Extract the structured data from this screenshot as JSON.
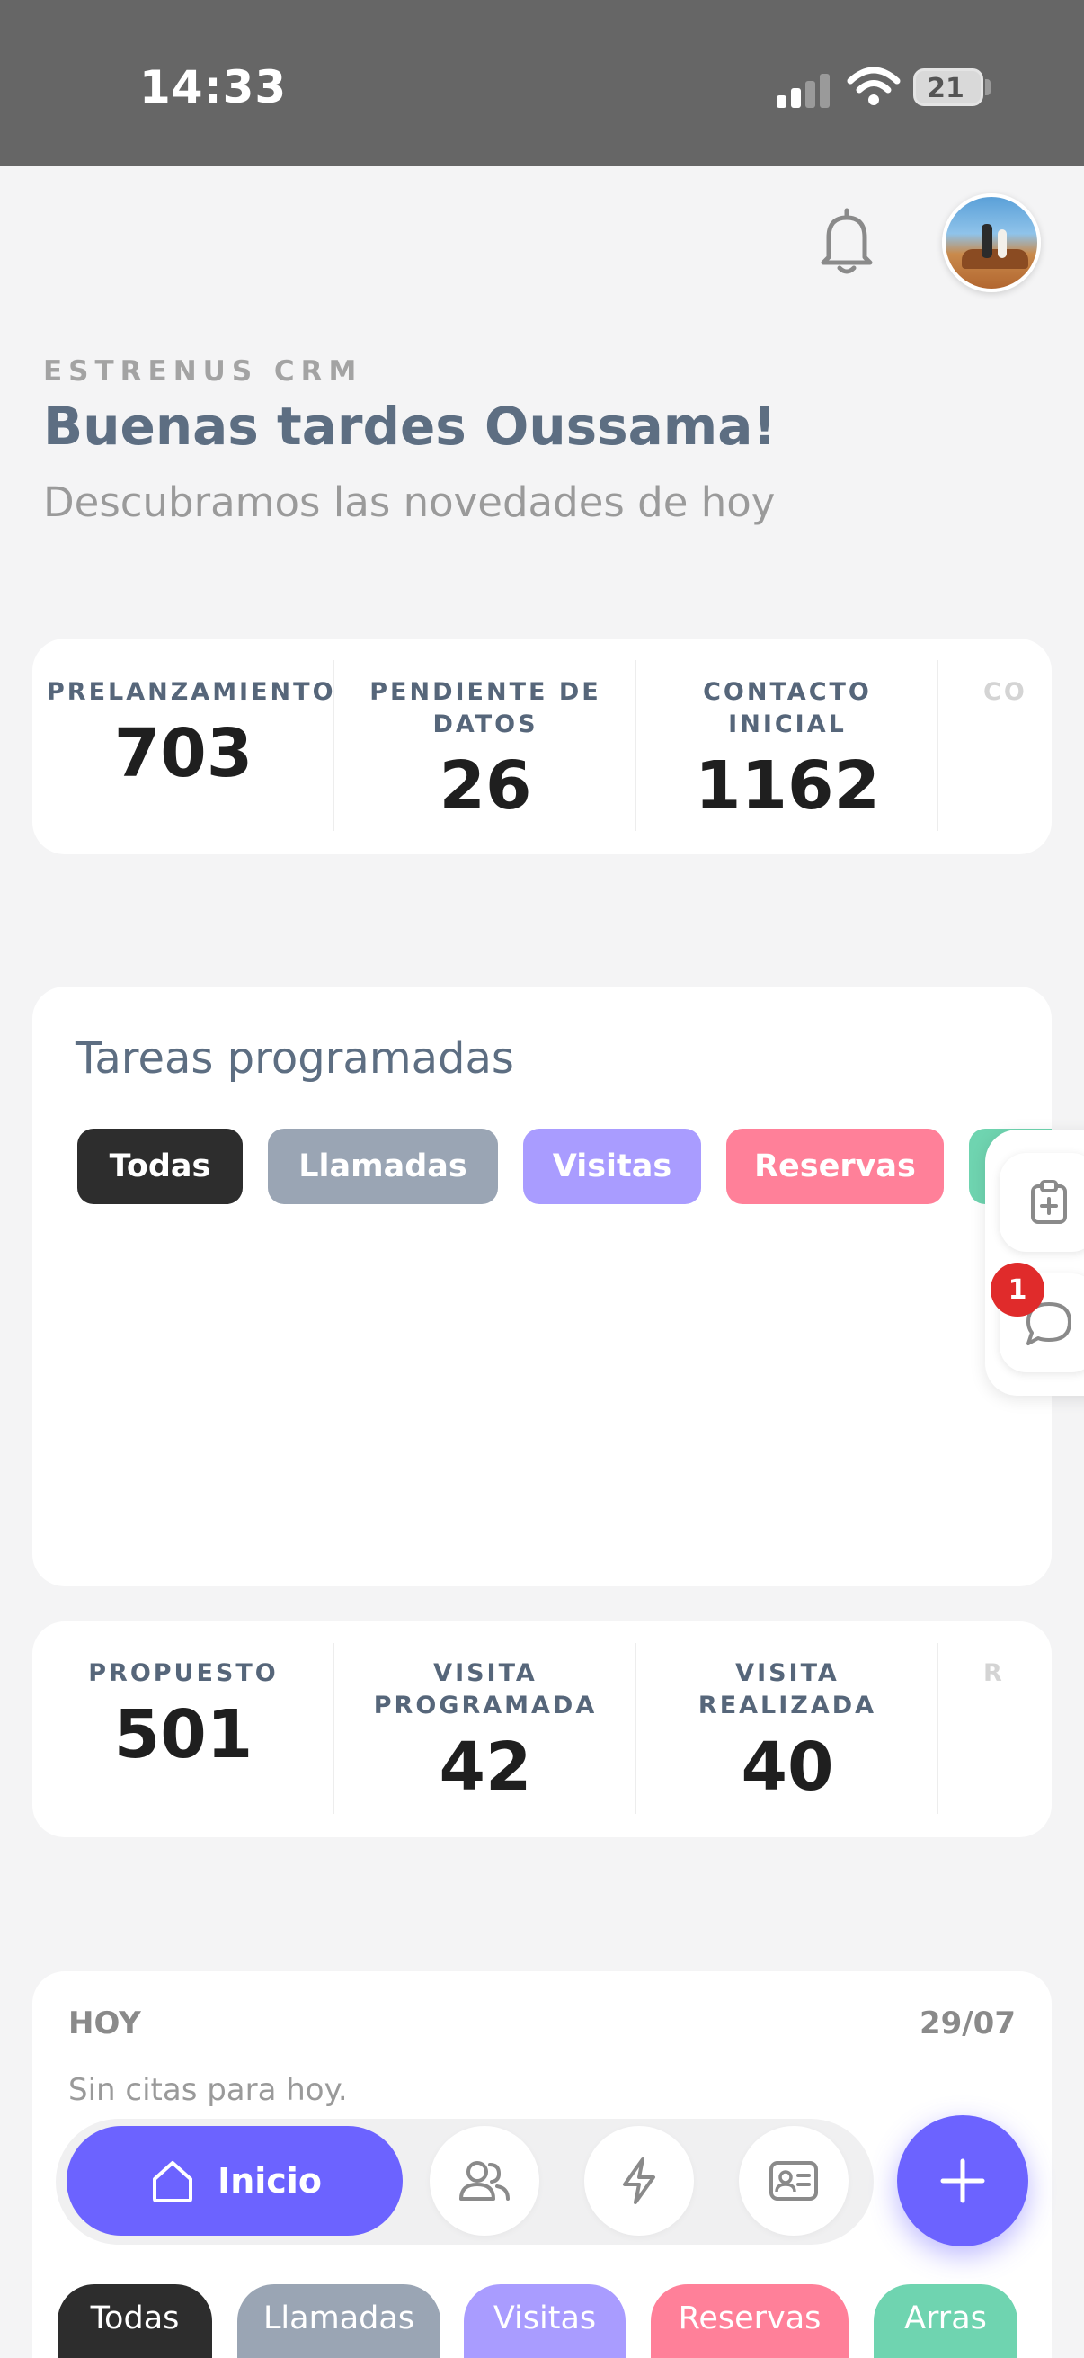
{
  "status_bar": {
    "time": "14:33",
    "battery": "21"
  },
  "header": {
    "brand": "ESTRENUS CRM",
    "greeting": "Buenas tardes Oussama!",
    "subtitle": "Descubramos las novedades de hoy"
  },
  "stats_top": [
    {
      "label": "PRELANZAMIENTO",
      "value": "703"
    },
    {
      "label": "PENDIENTE DE DATOS",
      "value": "26"
    },
    {
      "label": "CONTACTO INICIAL",
      "value": "1162"
    },
    {
      "label": "CO",
      "value": ""
    }
  ],
  "tasks": {
    "title": "Tareas programadas",
    "filters": [
      {
        "label": "Todas",
        "color": "#2d2d2d"
      },
      {
        "label": "Llamadas",
        "color": "#9aa5b4"
      },
      {
        "label": "Visitas",
        "color": "#a99cff"
      },
      {
        "label": "Reservas",
        "color": "#ff8099"
      },
      {
        "label": "",
        "color": "#6fd4b0"
      }
    ]
  },
  "side_tools": {
    "chat_badge": "1"
  },
  "stats_bottom": [
    {
      "label": "PROPUESTO",
      "value": "501"
    },
    {
      "label": "VISITA PROGRAMADA",
      "value": "42"
    },
    {
      "label": "VISITA REALIZADA",
      "value": "40"
    },
    {
      "label": "R",
      "value": ""
    }
  ],
  "today": {
    "label": "HOY",
    "date": "29/07",
    "empty": "Sin citas para hoy."
  },
  "nav": {
    "home_label": "Inicio",
    "accent": "#6c63ff"
  },
  "bottom_filters": [
    {
      "label": "Todas",
      "color": "#2d2d2d"
    },
    {
      "label": "Llamadas",
      "color": "#9aa5b4"
    },
    {
      "label": "Visitas",
      "color": "#a99cff"
    },
    {
      "label": "Reservas",
      "color": "#ff8099"
    },
    {
      "label": "Arras",
      "color": "#6fd4b0"
    }
  ]
}
